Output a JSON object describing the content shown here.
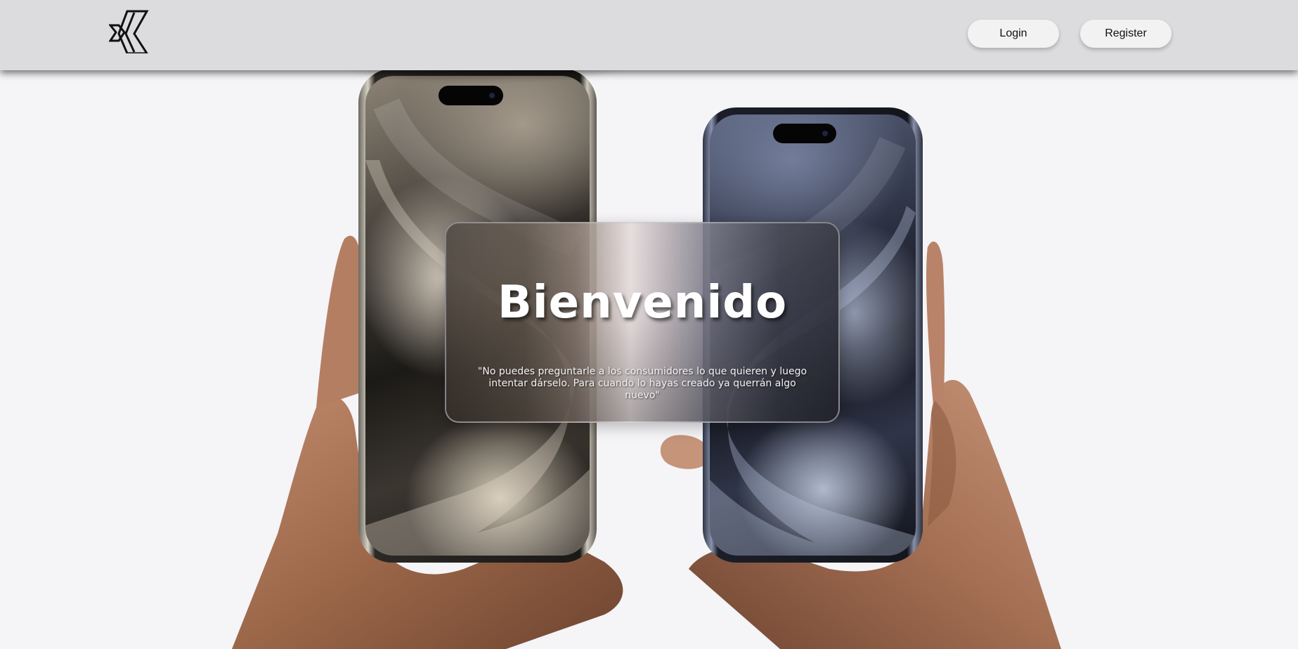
{
  "header": {
    "logo_name": "brand-logo",
    "login_label": "Login",
    "register_label": "Register"
  },
  "hero": {
    "title": "Bienvenido",
    "quote": "\"No puedes preguntarle a los consumidores lo que quieren y luego intentar dárselo. Para cuando lo hayas creado ya querrán algo nuevo\""
  },
  "colors": {
    "page_background": "#f5f4f7",
    "header_background": "#dcdcde",
    "button_background": "#f2f2f2",
    "title_text": "#ffffff"
  },
  "images": {
    "left_phone": "natural-titanium-phone",
    "right_phone": "blue-titanium-phone",
    "hands": "hands-holding-phones"
  }
}
